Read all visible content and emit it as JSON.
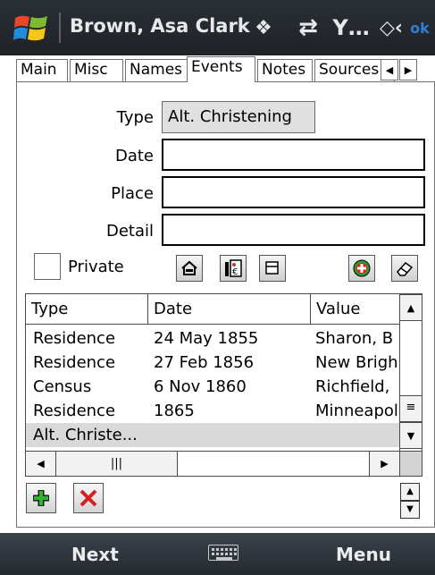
{
  "titlebar": {
    "title": "Brown, Asa Clark",
    "icons": [
      "windows-start-icon",
      "bluetooth-icon",
      "sync-icon",
      "signal-icon",
      "volume-icon"
    ],
    "ok_label": "ok"
  },
  "tabs": [
    {
      "label": "Main",
      "active": false
    },
    {
      "label": "Misc",
      "active": false
    },
    {
      "label": "Names",
      "active": false
    },
    {
      "label": "Events",
      "active": true
    },
    {
      "label": "Notes",
      "active": false
    },
    {
      "label": "Sources",
      "active": false
    }
  ],
  "form": {
    "type_label": "Type",
    "type_value": "Alt. Christening",
    "date_label": "Date",
    "date_value": "",
    "place_label": "Place",
    "place_value": "",
    "detail_label": "Detail",
    "detail_value": "",
    "private_label": "Private",
    "private_checked": false
  },
  "toolbar_icons": [
    "home-icon",
    "source-citation-icon",
    "copy-icon",
    "add-green-icon",
    "eraser-icon"
  ],
  "event_list": {
    "columns": [
      "Type",
      "Date",
      "Value"
    ],
    "rows": [
      {
        "type": "Residence",
        "date": "24 May 1855",
        "value": "Sharon, B"
      },
      {
        "type": "Residence",
        "date": "27 Feb 1856",
        "value": "New Brigh"
      },
      {
        "type": "Census",
        "date": "6 Nov 1860",
        "value": "Richfield,"
      },
      {
        "type": "Residence",
        "date": "1865",
        "value": "Minneapol"
      },
      {
        "type": "Alt. Christe...",
        "date": "",
        "value": "",
        "selected": true
      }
    ]
  },
  "softkeys": {
    "left": "Next",
    "right": "Menu"
  },
  "colors": {
    "titlebar": "#22272d",
    "accent_ok": "#2f7fd6",
    "add_green": "#2e9b2e",
    "delete_red": "#d42020",
    "selection": "#d9d9d9"
  }
}
